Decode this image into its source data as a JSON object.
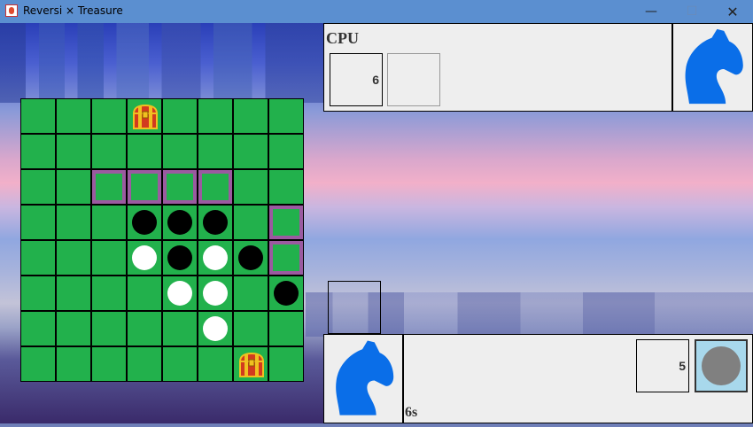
{
  "window": {
    "title": "Reversi × Treasure",
    "minimize": "—",
    "maximize": "☐",
    "close": "✕"
  },
  "board": {
    "rows": [
      [
        "",
        "",
        "",
        "T",
        "",
        "",
        "",
        ""
      ],
      [
        "",
        "",
        "",
        "",
        "",
        "",
        "",
        ""
      ],
      [
        "",
        "",
        "v",
        "v",
        "v",
        "v",
        "",
        ""
      ],
      [
        "",
        "",
        "",
        "B",
        "B",
        "B",
        "",
        "v"
      ],
      [
        "",
        "",
        "",
        "W",
        "B",
        "W",
        "B",
        "v"
      ],
      [
        "",
        "",
        "",
        "",
        "W",
        "W",
        "",
        "B"
      ],
      [
        "",
        "",
        "",
        "",
        "",
        "W",
        "",
        ""
      ],
      [
        "",
        "",
        "",
        "",
        "",
        "",
        "T",
        ""
      ]
    ]
  },
  "cpu": {
    "name": "CPU",
    "count": "6",
    "avatar_icon": "horse-head-icon"
  },
  "player": {
    "count": "5",
    "timer": "6s",
    "stone_color": "#808080",
    "avatar_icon": "horse-head-icon"
  },
  "colors": {
    "board": "#22b14c",
    "valid_move": "#9b5aa0",
    "avatar": "#0a6ee8",
    "stone_panel": "#a8d8ec"
  }
}
